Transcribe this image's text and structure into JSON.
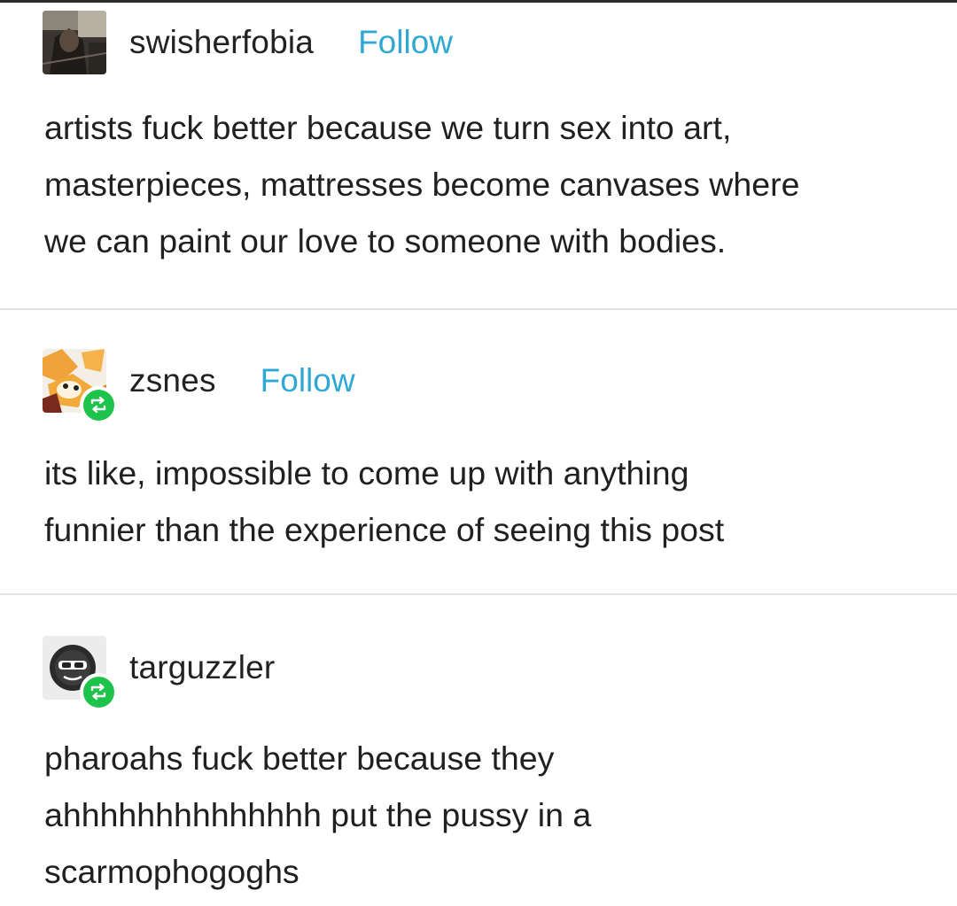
{
  "posts": [
    {
      "username": "swisherfobia",
      "follow_label": "Follow",
      "avatar_icon": "photo-avatar-icon",
      "is_reblog": false,
      "lines": [
        "artists fuck better because we turn sex into art,",
        "masterpieces, mattresses become canvases where",
        "we can paint our love to someone with bodies."
      ]
    },
    {
      "username": "zsnes",
      "follow_label": "Follow",
      "avatar_icon": "cartoon-fox-avatar-icon",
      "is_reblog": true,
      "lines": [
        "its like, impossible to come up with anything",
        "funnier than the experience of seeing this post"
      ]
    },
    {
      "username": "targuzzler",
      "follow_label": "",
      "avatar_icon": "sunglasses-face-avatar-icon",
      "is_reblog": true,
      "lines": [
        "pharoahs fuck better because they",
        "ahhhhhhhhhhhhhh put the pussy in a",
        "scarmophogoghs"
      ]
    }
  ],
  "colors": {
    "follow": "#2fa8d4",
    "reblog_badge": "#1ec34b",
    "divider": "#e3e3e3"
  }
}
